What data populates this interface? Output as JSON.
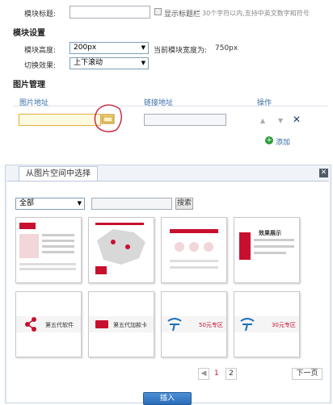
{
  "module": {
    "title_label": "模块标题:",
    "title_value": "",
    "show_title_label": "显示标题栏",
    "title_hint": "30个字符以内,支持中英文数字和符号"
  },
  "settings": {
    "heading": "模块设置",
    "height_label": "模块高度:",
    "height_value": "200px",
    "width_label": "当前模块宽度为:",
    "width_value": "750px",
    "effect_label": "切换效果:",
    "effect_value": "上下滚动"
  },
  "images": {
    "heading": "图片管理",
    "col_image": "图片地址",
    "col_link": "链接地址",
    "col_action": "操作",
    "add_label": "添加"
  },
  "picker": {
    "tab_label": "从图片空间中选择",
    "category_value": "全部",
    "search_placeholder": "",
    "search_button": "搜索",
    "thumbs": [
      {
        "name": "thumb-1",
        "caption": ""
      },
      {
        "name": "thumb-2",
        "caption": ""
      },
      {
        "name": "thumb-3",
        "caption": ""
      },
      {
        "name": "thumb-4",
        "caption": "效果展示"
      },
      {
        "name": "thumb-5",
        "caption": "第五代软件"
      },
      {
        "name": "thumb-6",
        "caption": "第五代加款卡"
      },
      {
        "name": "thumb-7",
        "caption": "50元专区"
      },
      {
        "name": "thumb-8",
        "caption": "30元专区"
      }
    ],
    "pagination": {
      "current": "1",
      "page2": "2",
      "next_label": "下一页"
    },
    "insert_button": "插入"
  },
  "colors": {
    "accent_red": "#c8102e",
    "link_blue": "#3a6ea5",
    "add_green": "#2a9d3a"
  }
}
